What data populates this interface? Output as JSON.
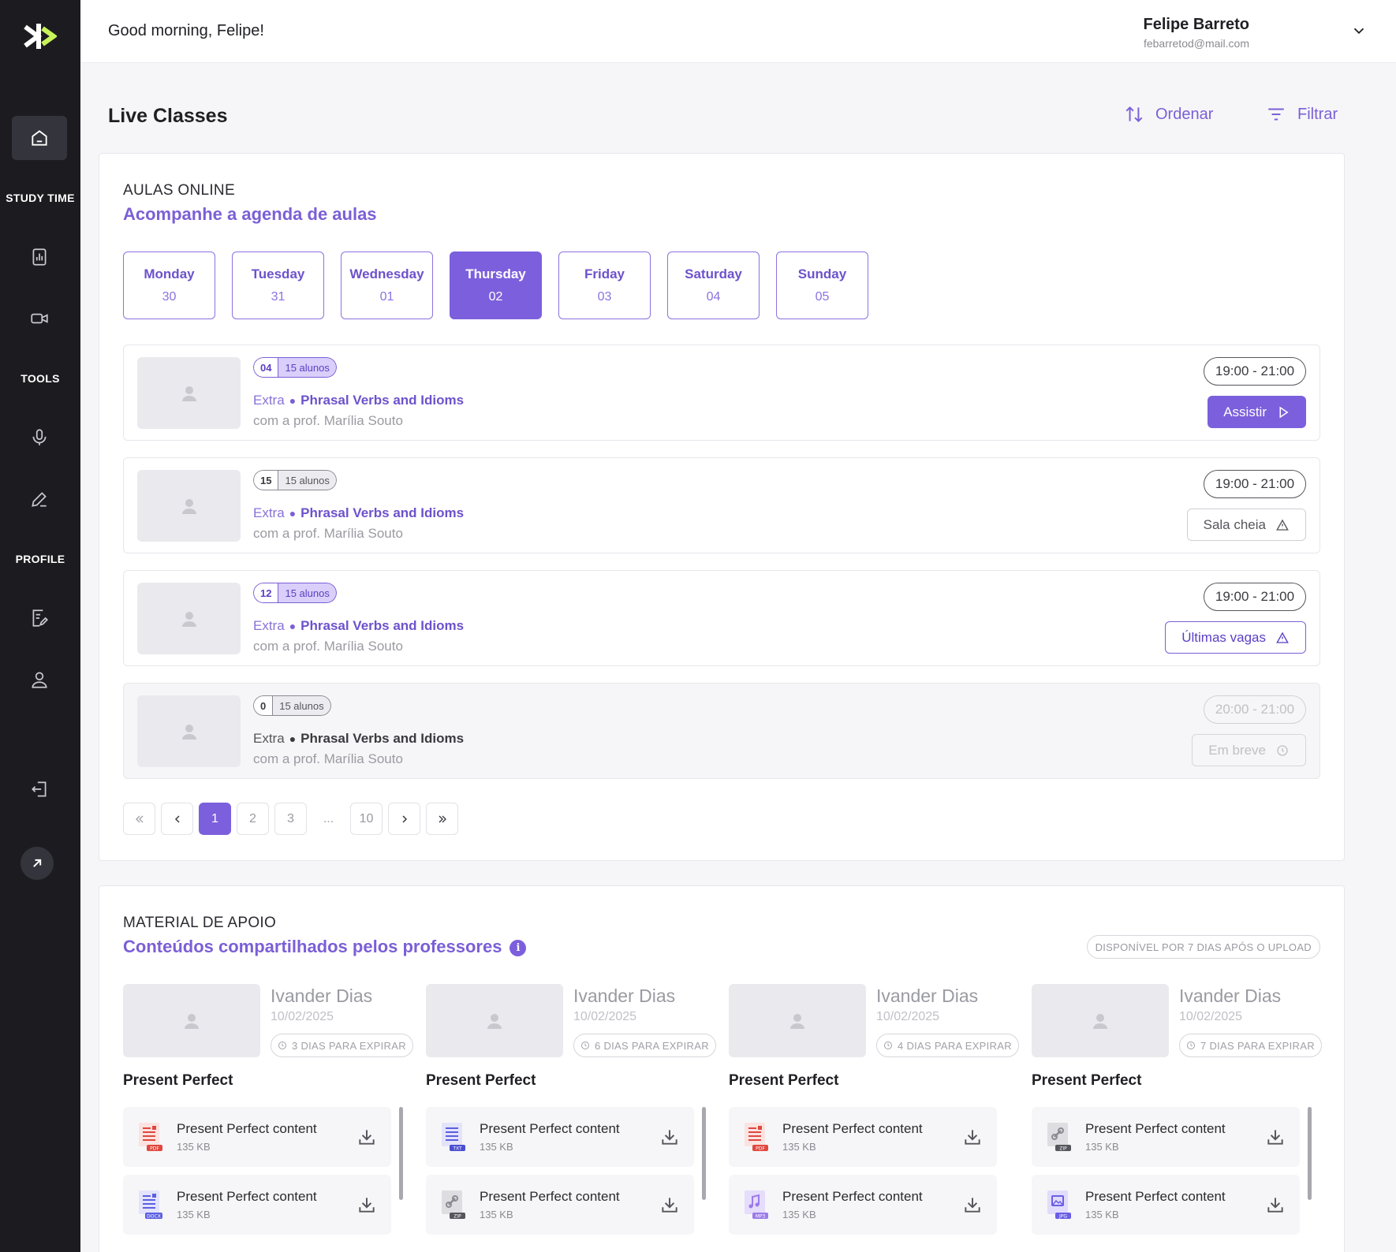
{
  "header": {
    "greeting": "Good morning, Felipe!",
    "user_name": "Felipe Barreto",
    "user_email": "febarretod@mail.com"
  },
  "sidebar": {
    "sections": [
      "STUDY TIME",
      "TOOLS",
      "PROFILE"
    ],
    "items": [
      {
        "icon": "home-icon",
        "active": true
      },
      {
        "icon": "chart-icon"
      },
      {
        "icon": "video-icon"
      },
      {
        "icon": "microphone-icon"
      },
      {
        "icon": "pen-icon"
      },
      {
        "icon": "document-edit-icon"
      },
      {
        "icon": "user-icon"
      },
      {
        "icon": "logout-icon"
      }
    ]
  },
  "page": {
    "title": "Live Classes",
    "sort_label": "Ordenar",
    "filter_label": "Filtrar"
  },
  "live": {
    "eyebrow": "AULAS ONLINE",
    "subtitle": "Acompanhe a agenda de aulas",
    "days": [
      {
        "name": "Monday",
        "num": "30"
      },
      {
        "name": "Tuesday",
        "num": "31"
      },
      {
        "name": "Wednesday",
        "num": "01"
      },
      {
        "name": "Thursday",
        "num": "02",
        "active": true
      },
      {
        "name": "Friday",
        "num": "03"
      },
      {
        "name": "Saturday",
        "num": "04"
      },
      {
        "name": "Sunday",
        "num": "05"
      }
    ],
    "classes": [
      {
        "count": "04",
        "capacity": "15 alunos",
        "badge_style": "purple",
        "category": "Extra",
        "name": "Phrasal Verbs and Idioms",
        "teacher": "com a prof. Marília Souto",
        "time": "19:00 - 21:00",
        "action": "Assistir",
        "action_style": "primary",
        "action_icon": "play-icon"
      },
      {
        "count": "15",
        "capacity": "15 alunos",
        "badge_style": "gray",
        "category": "Extra",
        "name": "Phrasal Verbs and Idioms",
        "teacher": "com a prof. Marília Souto",
        "time": "19:00 - 21:00",
        "action": "Sala cheia",
        "action_style": "gray",
        "action_icon": "warning-icon"
      },
      {
        "count": "12",
        "capacity": "15 alunos",
        "badge_style": "purple",
        "category": "Extra",
        "name": "Phrasal Verbs and Idioms",
        "teacher": "com a prof. Marília Souto",
        "time": "19:00 - 21:00",
        "action": "Últimas vagas",
        "action_style": "outline",
        "action_icon": "warning-icon"
      },
      {
        "count": "0",
        "capacity": "15 alunos",
        "badge_style": "gray",
        "category": "Extra",
        "name": "Phrasal Verbs and Idioms",
        "teacher": "com a prof. Marília Souto",
        "time": "20:00 - 21:00",
        "action": "Em breve",
        "action_style": "faded",
        "action_icon": "clock-icon",
        "disabled": true
      }
    ],
    "pagination": {
      "pages": [
        "1",
        "2",
        "3",
        "...",
        "10"
      ],
      "current": "1"
    }
  },
  "material": {
    "eyebrow": "MATERIAL DE APOIO",
    "subtitle": "Conteúdos compartilhados pelos professores",
    "availability": "DISPONÍVEL POR 7 DIAS APÓS O UPLOAD",
    "columns": [
      {
        "author": "Ivander Dias",
        "date": "10/02/2025",
        "expire": "3 DIAS PARA EXPIRAR",
        "title": "Present Perfect",
        "files": [
          {
            "name": "Present Perfect content",
            "size": "135 KB",
            "type": "PDF",
            "color": "#e0473e"
          },
          {
            "name": "Present Perfect content",
            "size": "135 KB",
            "type": "DOCX",
            "color": "#5b5fe0"
          }
        ]
      },
      {
        "author": "Ivander Dias",
        "date": "10/02/2025",
        "expire": "6 DIAS PARA EXPIRAR",
        "title": "Present Perfect",
        "files": [
          {
            "name": "Present Perfect content",
            "size": "135 KB",
            "type": "TXT",
            "color": "#5b5fe0"
          },
          {
            "name": "Present Perfect content",
            "size": "135 KB",
            "type": "ZIP",
            "color": "#8a8a92"
          }
        ]
      },
      {
        "author": "Ivander Dias",
        "date": "10/02/2025",
        "expire": "4 DIAS PARA EXPIRAR",
        "title": "Present Perfect",
        "files": [
          {
            "name": "Present Perfect content",
            "size": "135 KB",
            "type": "PDF",
            "color": "#e0473e"
          },
          {
            "name": "Present Perfect content",
            "size": "135 KB",
            "type": "MP3",
            "color": "#9b7be8"
          }
        ]
      },
      {
        "author": "Ivander Dias",
        "date": "10/02/2025",
        "expire": "7 DIAS PARA EXPIRAR",
        "title": "Present Perfect",
        "files": [
          {
            "name": "Present Perfect content",
            "size": "135 KB",
            "type": "ZIP",
            "color": "#8a8a92"
          },
          {
            "name": "Present Perfect content",
            "size": "135 KB",
            "type": "JPG",
            "color": "#6a5ee6"
          }
        ]
      }
    ]
  },
  "colors": {
    "accent": "#7c5fdc",
    "sidebar": "#1c1c20",
    "logo_accent": "#c8f25a"
  }
}
